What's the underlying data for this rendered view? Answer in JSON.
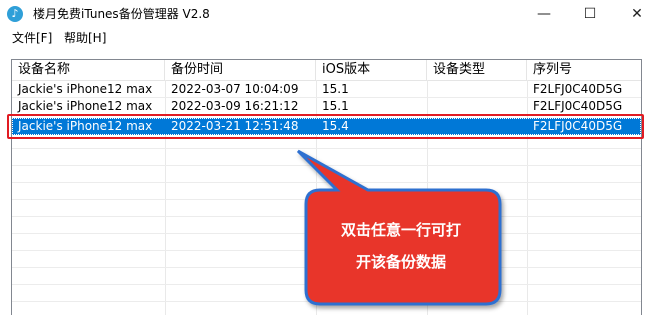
{
  "window": {
    "title": "楼月免费iTunes备份管理器 V2.8",
    "controls": {
      "minimize": "—",
      "maximize": "☐",
      "close": "✕"
    },
    "icon": "music-note-icon"
  },
  "menu": [
    {
      "label": "文件[F]"
    },
    {
      "label": "帮助[H]"
    }
  ],
  "table": {
    "columns": [
      "设备名称",
      "备份时间",
      "iOS版本",
      "设备类型",
      "序列号"
    ],
    "rows": [
      {
        "device": "Jackie's iPhone12 max",
        "time": "2022-03-07 10:04:09",
        "ios": "15.1",
        "type": "",
        "serial": "F2LFJ0C40D5G",
        "selected": false
      },
      {
        "device": "Jackie's iPhone12 max",
        "time": "2022-03-09 16:21:12",
        "ios": "15.1",
        "type": "",
        "serial": "F2LFJ0C40D5G",
        "selected": false
      },
      {
        "device": "Jackie's iPhone12 max",
        "time": "2022-03-21 12:51:48",
        "ios": "15.4",
        "type": "",
        "serial": "F2LFJ0C40D5G",
        "selected": true
      }
    ]
  },
  "callout": {
    "line1": "双击任意一行可打",
    "line2": "开该备份数据"
  },
  "colors": {
    "selection": "#0078d7",
    "highlight_border": "#e11b22",
    "callout_fill": "#e8352b",
    "callout_border": "#2e6fd0"
  }
}
